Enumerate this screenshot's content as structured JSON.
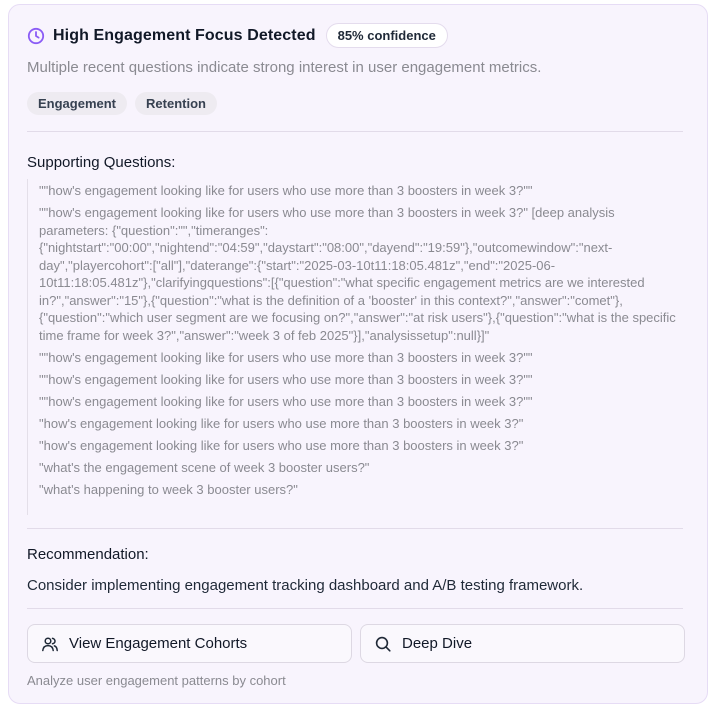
{
  "header": {
    "icon": "clock-icon",
    "title": "High Engagement Focus Detected",
    "confidence": "85% confidence"
  },
  "subtitle": "Multiple recent questions indicate strong interest in user engagement metrics.",
  "tags": [
    "Engagement",
    "Retention"
  ],
  "supporting": {
    "label": "Supporting Questions:",
    "questions": [
      "\"\"how's engagement looking like for users who use more than 3 boosters in week 3?\"\"",
      "\"\"how's engagement looking like for users who use more than 3 boosters in week 3?\" [deep analysis parameters: {\"question\":\"\",\"timeranges\": {\"nightstart\":\"00:00\",\"nightend\":\"04:59\",\"daystart\":\"08:00\",\"dayend\":\"19:59\"},\"outcomewindow\":\"next-day\",\"playercohort\":[\"all\"],\"daterange\":{\"start\":\"2025-03-10t11:18:05.481z\",\"end\":\"2025-06-10t11:18:05.481z\"},\"clarifyingquestions\":[{\"question\":\"what specific engagement metrics are we interested in?\",\"answer\":\"15\"},{\"question\":\"what is the definition of a 'booster' in this context?\",\"answer\":\"comet\"},{\"question\":\"which user segment are we focusing on?\",\"answer\":\"at risk users\"},{\"question\":\"what is the specific time frame for week 3?\",\"answer\":\"week 3 of feb 2025\"}],\"analysissetup\":null}]\"",
      "\"\"how's engagement looking like for users who use more than 3 boosters in week 3?\"\"",
      "\"\"how's engagement looking like for users who use more than 3 boosters in week 3?\"\"",
      "\"\"how's engagement looking like for users who use more than 3 boosters in week 3?\"\"",
      "\"how's engagement looking like for users who use more than 3 boosters in week 3?\"",
      "\"how's engagement looking like for users who use more than 3 boosters in week 3?\"",
      "\"what's the engagement scene of week 3 booster users?\"",
      "\"what's happening to week 3 booster users?\""
    ]
  },
  "recommendation": {
    "label": "Recommendation:",
    "text": "Consider implementing engagement tracking dashboard and A/B testing framework."
  },
  "actions": [
    {
      "label": "View Engagement Cohorts",
      "icon": "users-icon"
    },
    {
      "label": "Deep Dive",
      "icon": "search-icon"
    }
  ],
  "footer_note": "Analyze user engagement patterns by cohort",
  "colors": {
    "accent": "#8b5cf6",
    "card_bg": "#f8f4fd",
    "muted_text": "#8a8a91"
  }
}
